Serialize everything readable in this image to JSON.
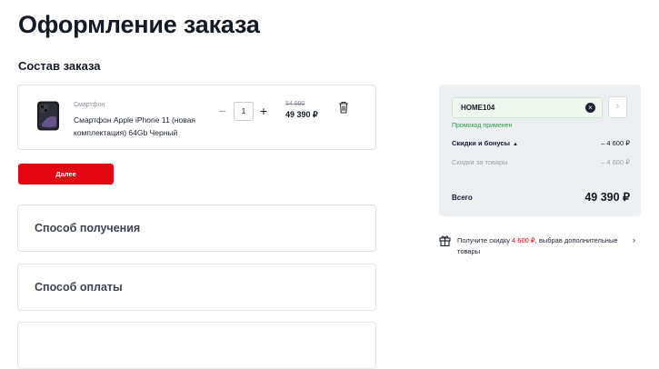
{
  "page": {
    "title": "Оформление заказа",
    "section_title": "Состав заказа"
  },
  "cart": {
    "items": [
      {
        "category": "Смартфон",
        "name": "Смартфон Apple iPhone 11 (новая комплектация) 64Gb Черный",
        "quantity": "1",
        "qty_minus": "−",
        "qty_plus": "+",
        "old_price": "54 990",
        "price": "49 390 ₽",
        "icon": "trash-icon"
      }
    ],
    "next_button": "Далее"
  },
  "steps": [
    {
      "label": "Способ получения"
    },
    {
      "label": "Способ оплаты"
    }
  ],
  "summary": {
    "promo_code": "HOME104",
    "promo_status": "Промокод применен",
    "discounts_label": "Скидки и бонусы",
    "discounts_value": "– 4 600 ₽",
    "goods_discount_label": "Скидки за товары",
    "goods_discount_value": "– 4 600 ₽",
    "total_label": "Всего",
    "total_value": "49 390 ₽"
  },
  "gift_offer": {
    "prefix": "Получите скидку",
    "amount": "4 600 ₽",
    "suffix": ", выбрав дополнительные товары",
    "icon": "gift-icon"
  },
  "colors": {
    "accent": "#e30613",
    "success": "#2e9a43",
    "summary_bg": "#edf0f3"
  }
}
